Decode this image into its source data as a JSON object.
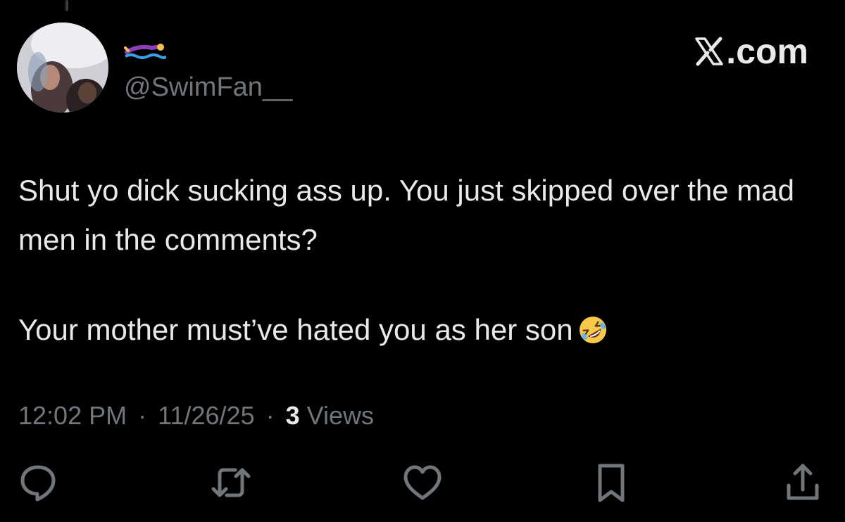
{
  "tweet": {
    "handle": "@SwimFan__",
    "brand": ".com",
    "text_lines": [
      "Shut yo dick sucking ass up. You just skipped over the mad men in the comments?",
      "Your mother must’ve hated you as her son"
    ],
    "time": "12:02 PM",
    "date": "11/26/25",
    "views_count": "3",
    "views_label": "Views",
    "separator": "·"
  },
  "icons": {
    "display_name_emoji": "swimmer-emoji",
    "trailing_emoji": "rolling-on-floor-laughing-emoji",
    "actions": [
      "reply-icon",
      "retweet-icon",
      "like-icon",
      "bookmark-icon",
      "share-icon"
    ]
  },
  "colors": {
    "background": "#000000",
    "text_primary": "#e7e9ea",
    "text_secondary": "#71767b"
  }
}
